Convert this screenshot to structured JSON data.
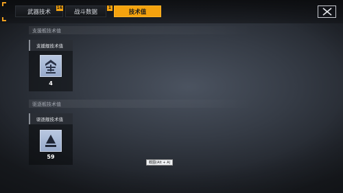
{
  "tabs": [
    {
      "label": "武器技术",
      "badge": "16",
      "active": false
    },
    {
      "label": "战斗数据",
      "badge": "1",
      "active": false
    },
    {
      "label": "技术值",
      "badge": "",
      "active": true
    }
  ],
  "close_icon": "close-icon",
  "sections": [
    {
      "title": "支援舰技术值",
      "card_label": "支援舰技术值",
      "icon": "support-ship-icon",
      "value": "4"
    },
    {
      "title": "驱逐舰技术值",
      "card_label": "驱逐舰技术值",
      "icon": "destroyer-icon",
      "value": "59"
    }
  ],
  "tooltip": "截图(Alt + A)",
  "colors": {
    "accent": "#f4a20e",
    "icon_bg": "#a9bad6"
  }
}
